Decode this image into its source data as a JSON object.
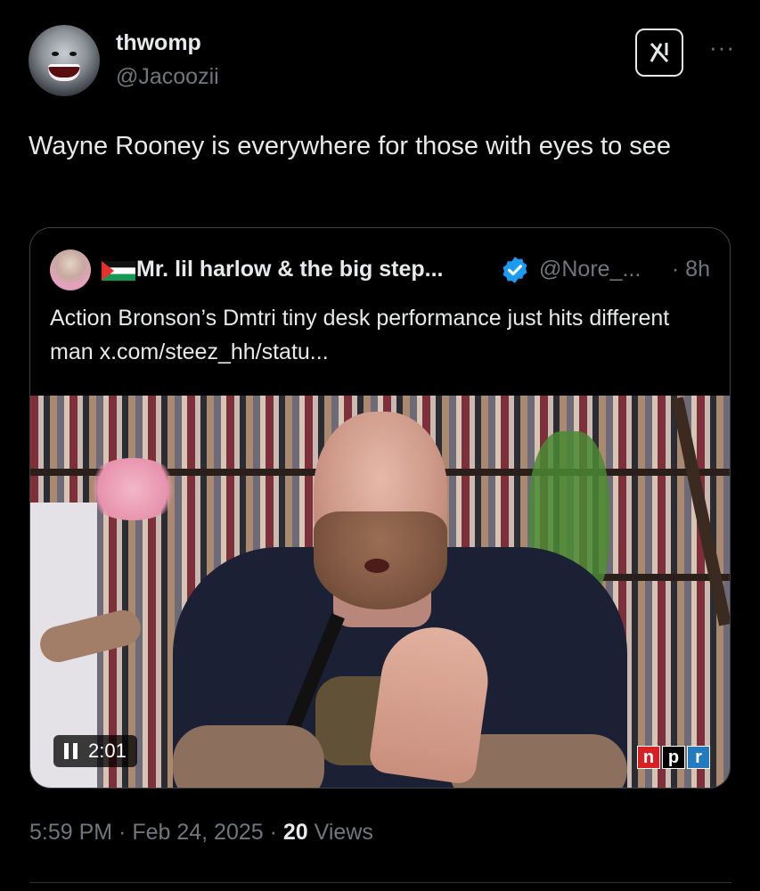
{
  "author": {
    "display_name": "thwomp",
    "handle": "@Jacoozii",
    "avatar_icon": "shark-avatar"
  },
  "header": {
    "grok_icon": "grok-icon",
    "more_label": "···"
  },
  "tweet": {
    "text": "Wayne Rooney is everywhere for those with eyes to see"
  },
  "quote": {
    "display_name": "Mr. lil harlow & the big step...",
    "handle": "@Nore_...",
    "time": "· 8h",
    "text": "Action Bronson’s Dmtri tiny desk performance just hits different man  x.com/steez_hh/statu...",
    "video": {
      "duration": "2:01",
      "watermark": [
        "n",
        "p",
        "r"
      ]
    }
  },
  "meta": {
    "time": "5:59 PM",
    "sep1": " · ",
    "date": "Feb 24, 2025",
    "sep2": " · ",
    "views_count": "20",
    "views_label": " Views"
  },
  "colors": {
    "background": "#000000",
    "text": "#e7e9ea",
    "muted": "#71767b",
    "verified_blue": "#1d9bf0",
    "border": "#3e4144"
  }
}
